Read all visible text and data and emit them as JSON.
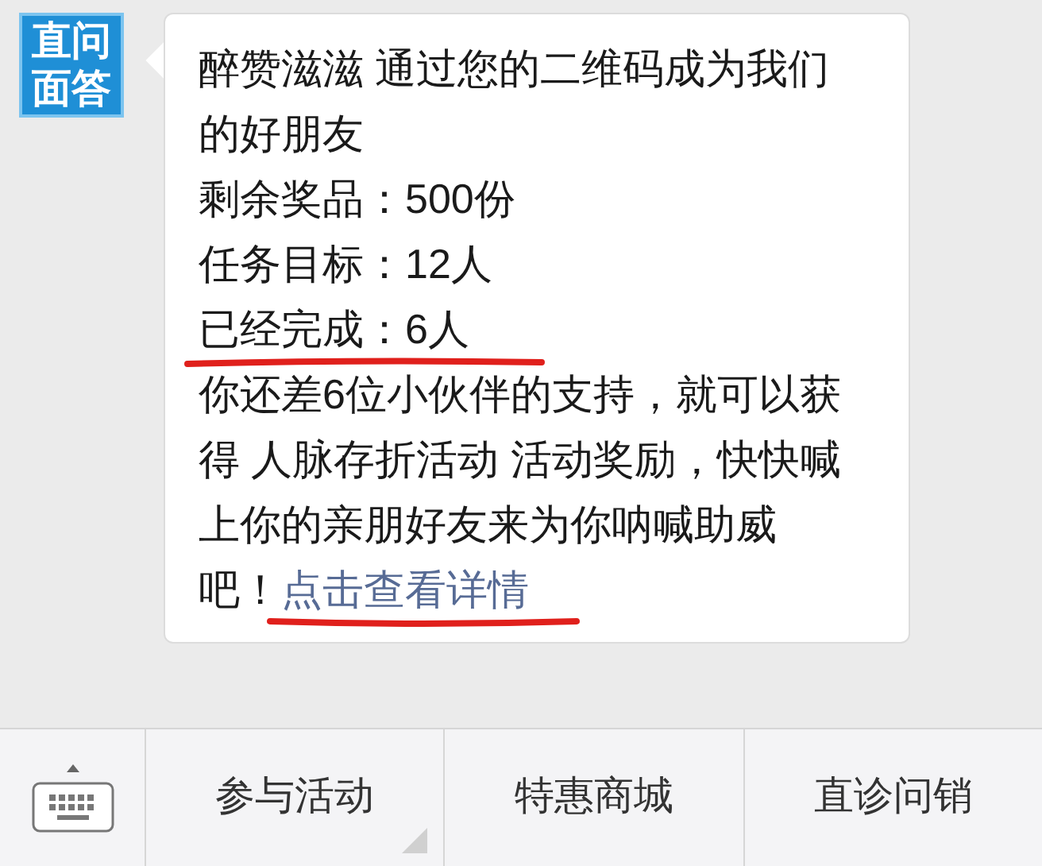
{
  "avatar": {
    "lines": [
      "直问",
      "面答"
    ]
  },
  "message": {
    "lines": [
      {
        "kind": "text",
        "text": "醉赞滋滋 通过您的二维码成为我们的好朋友",
        "marked": false
      },
      {
        "kind": "text",
        "text": "剩余奖品：500份",
        "marked": false
      },
      {
        "kind": "text",
        "text": "任务目标：12人",
        "marked": false
      },
      {
        "kind": "text",
        "text": "已经完成：6人",
        "marked": true
      },
      {
        "kind": "link_paragraph",
        "text": "你还差6位小伙伴的支持，就可以获得 人脉存折活动 活动奖励，快快喊上你的亲朋好友来为你呐喊助威吧！",
        "link": "点击查看详情",
        "marked": true
      }
    ]
  },
  "menu": [
    {
      "label": "参与活动",
      "has_submenu": true
    },
    {
      "label": "特惠商城",
      "has_submenu": false
    },
    {
      "label": "直诊问销",
      "has_submenu": false
    }
  ]
}
